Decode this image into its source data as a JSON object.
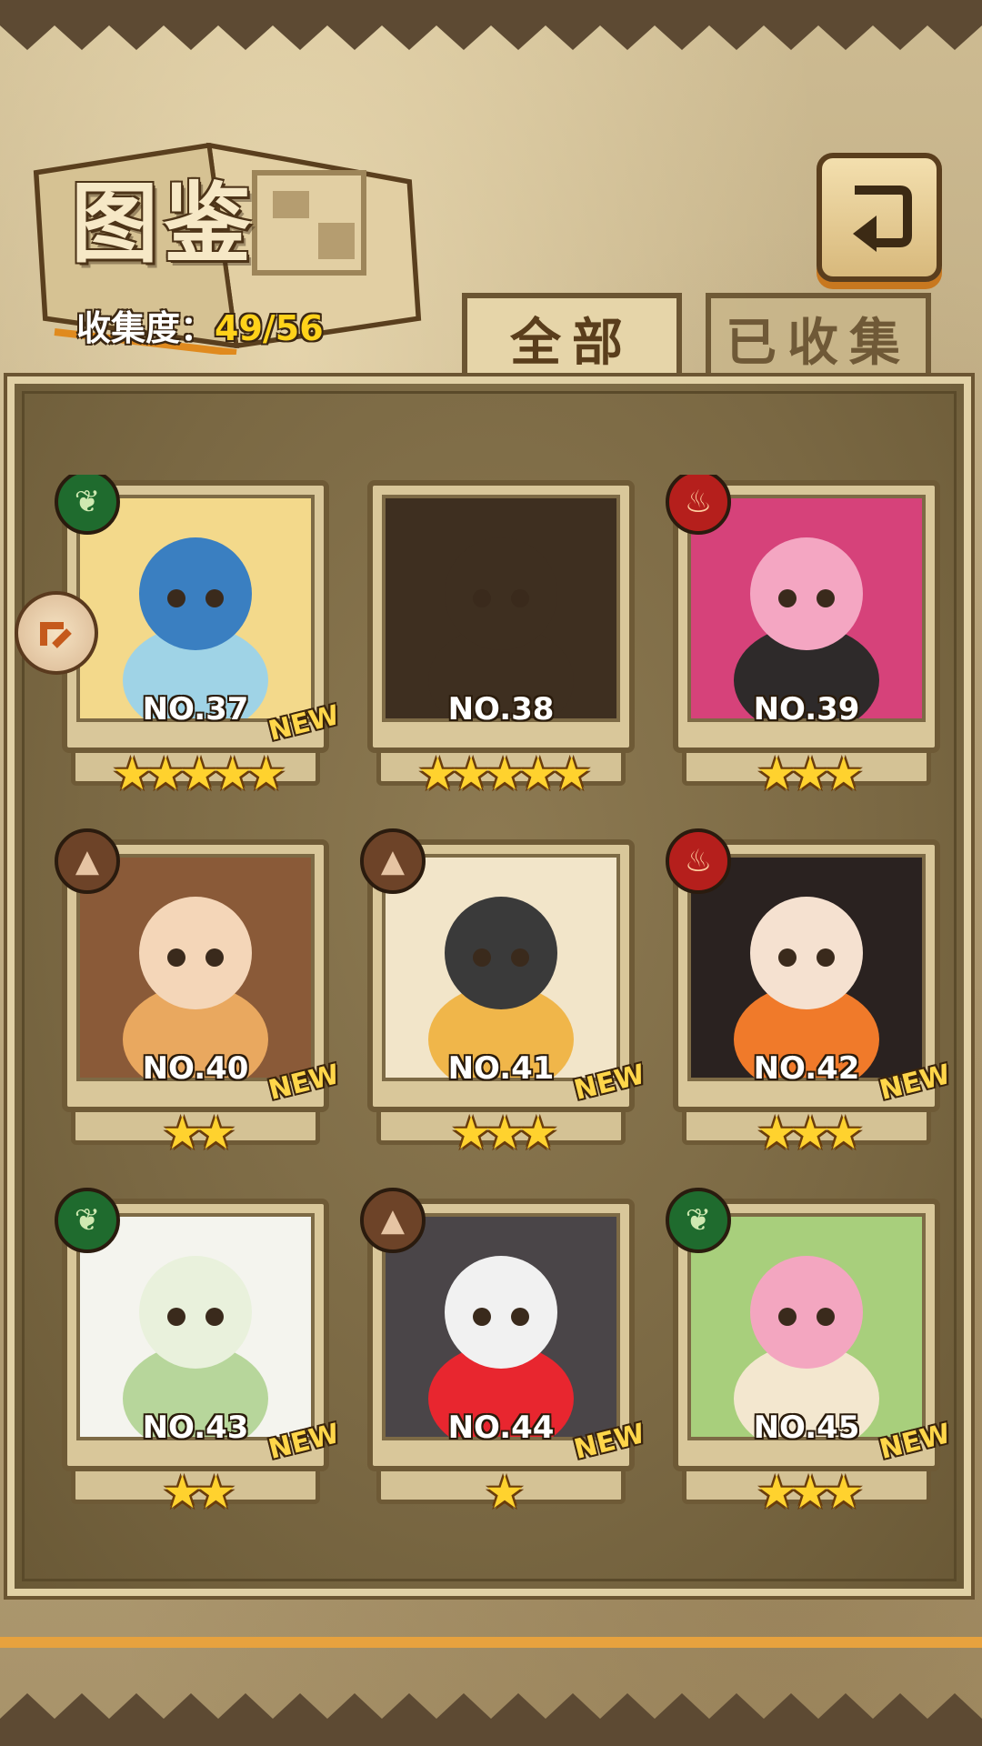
{
  "header": {
    "title": "图鉴",
    "collect_label": "收集度：",
    "collect_value": "49/56"
  },
  "tabs": [
    {
      "label": "全部",
      "active": true
    },
    {
      "label": "已收集",
      "active": false
    }
  ],
  "colors": {
    "star": "#ffd22e",
    "leaf": "#1f6b2e",
    "fire": "#b51f1c",
    "earth": "#6d4328",
    "new": "#ffd64a"
  },
  "cards": [
    {
      "no": "NO.37",
      "stars": "★★★★★",
      "element": "leaf-icon",
      "new": "NEW",
      "palette": [
        "#f3d98b",
        "#9fd3e6",
        "#3a7fc1"
      ]
    },
    {
      "no": "NO.38",
      "stars": "★★★★★",
      "element": "",
      "new": "",
      "palette": [
        "#3e2f20",
        "#3e2f20",
        "#3e2f20"
      ]
    },
    {
      "no": "NO.39",
      "stars": "★★★",
      "element": "fire-icon",
      "new": "",
      "palette": [
        "#d6427a",
        "#2e2a2a",
        "#f4a6c2"
      ]
    },
    {
      "no": "NO.40",
      "stars": "★★",
      "element": "earth-icon",
      "new": "NEW",
      "palette": [
        "#8a5a38",
        "#e9a85f",
        "#f4d6b8"
      ]
    },
    {
      "no": "NO.41",
      "stars": "★★★",
      "element": "earth-icon",
      "new": "NEW",
      "palette": [
        "#f2e5c9",
        "#f0b64a",
        "#3a3a3a"
      ]
    },
    {
      "no": "NO.42",
      "stars": "★★★",
      "element": "fire-icon",
      "new": "NEW",
      "palette": [
        "#2a2220",
        "#f07a2a",
        "#f5e1d0"
      ]
    },
    {
      "no": "NO.43",
      "stars": "★★",
      "element": "leaf-icon",
      "new": "NEW",
      "palette": [
        "#f4f4ee",
        "#b7d69b",
        "#e9f1dc"
      ]
    },
    {
      "no": "NO.44",
      "stars": "★",
      "element": "earth-icon",
      "new": "NEW",
      "palette": [
        "#4a4548",
        "#e8262f",
        "#f1f1f1"
      ]
    },
    {
      "no": "NO.45",
      "stars": "★★★",
      "element": "leaf-icon",
      "new": "NEW",
      "palette": [
        "#a8cf7c",
        "#f3e7cf",
        "#f3a6c0"
      ]
    }
  ]
}
